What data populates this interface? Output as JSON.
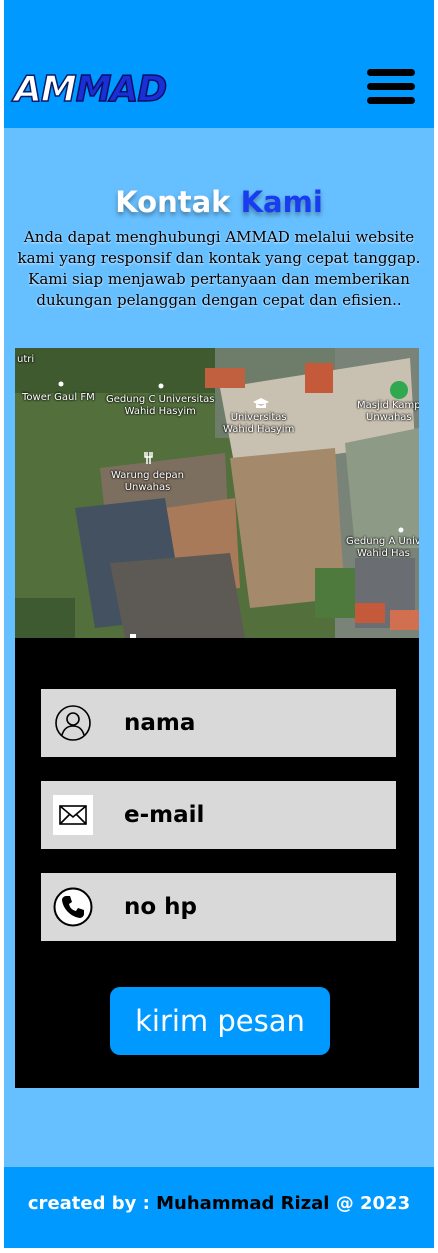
{
  "header": {
    "logo_part1": "AM",
    "logo_part2": "MAD",
    "menu_icon": "hamburger-menu-icon"
  },
  "contact": {
    "title_part1": "Kontak",
    "title_part2": "Kami",
    "description": "Anda dapat menghubungi AMMAD melalui website kami yang responsif dan kontak yang cepat tanggap. Kami siap menjawab pertanyaan dan memberikan dukungan pelanggan dengan cepat dan efisien.."
  },
  "map": {
    "labels": {
      "utri": "utri",
      "tower": "Tower Gaul FM",
      "gedung_c": "Gedung C Universitas\nWahid Hasyim",
      "universitas": "Universitas\nWahid Hasyim",
      "masjid": "Masjid Kamp\nUnwahas",
      "warung": "Warung depan\nUnwahas",
      "gedung_a": "Gedung A Univ\nWahid Has"
    }
  },
  "form": {
    "name_field": {
      "label": "nama",
      "icon": "user-icon"
    },
    "email_field": {
      "label": "e-mail",
      "icon": "envelope-icon"
    },
    "phone_field": {
      "label": "no hp",
      "icon": "phone-icon"
    },
    "submit_label": "kirim pesan"
  },
  "footer": {
    "created_by": "created by :",
    "author": "Muhammad Rizal",
    "year": "@ 2023"
  },
  "colors": {
    "header_bg": "#0099ff",
    "page_bg": "#66bfff",
    "form_bg": "#000000",
    "field_bg": "#d9d9d9",
    "accent_blue": "#1a3cf0"
  }
}
